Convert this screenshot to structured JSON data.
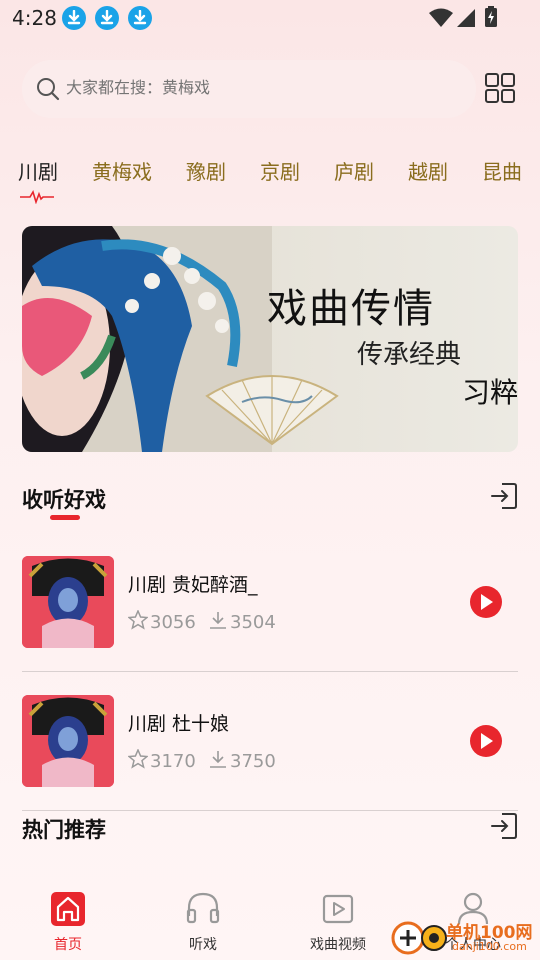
{
  "status": {
    "time": "4:28",
    "icons": [
      "download-icon",
      "download-icon",
      "download-icon",
      "wifi-icon",
      "signal-icon",
      "battery-icon"
    ]
  },
  "search": {
    "placeholder": "大家都在搜：黄梅戏"
  },
  "tabs": [
    {
      "label": "川剧",
      "active": true
    },
    {
      "label": "黄梅戏"
    },
    {
      "label": "豫剧"
    },
    {
      "label": "京剧"
    },
    {
      "label": "庐剧"
    },
    {
      "label": "越剧"
    },
    {
      "label": "昆曲"
    }
  ],
  "banner": {
    "title": "戏曲传情",
    "subtitle": "传承经典",
    "mark": "习粹"
  },
  "section_listen": {
    "title": "收听好戏"
  },
  "items": [
    {
      "title": "川剧 贵妃醉酒_",
      "favorites": "3056",
      "downloads": "3504"
    },
    {
      "title": "川剧 杜十娘",
      "favorites": "3170",
      "downloads": "3750"
    }
  ],
  "section_hot": {
    "title": "热门推荐"
  },
  "nav": [
    {
      "label": "首页",
      "icon": "home-icon",
      "active": true
    },
    {
      "label": "听戏",
      "icon": "headphones-icon"
    },
    {
      "label": "戏曲视频",
      "icon": "video-icon"
    },
    {
      "label": "个人中心",
      "icon": "user-icon"
    }
  ],
  "watermark": {
    "text": "单机100网",
    "url": "danji100.com"
  },
  "colors": {
    "accent": "#e8262d",
    "tab_inactive": "#8a6d1e",
    "download_icon": "#1aa3e8"
  }
}
